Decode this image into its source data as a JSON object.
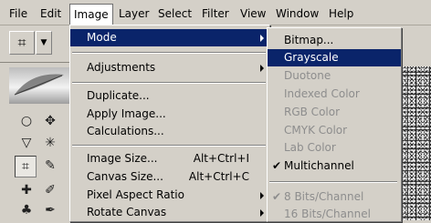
{
  "menubar": {
    "items": [
      "File",
      "Edit",
      "Image",
      "Layer",
      "Select",
      "Filter",
      "View",
      "Window",
      "Help"
    ],
    "active": "Image"
  },
  "image_menu": {
    "items": [
      {
        "label": "Mode",
        "has_submenu": true,
        "highlighted": true
      },
      {
        "label": "Adjustments",
        "has_submenu": true
      },
      {
        "label": "Duplicate..."
      },
      {
        "label": "Apply Image..."
      },
      {
        "label": "Calculations..."
      },
      {
        "label": "Image Size...",
        "shortcut": "Alt+Ctrl+I"
      },
      {
        "label": "Canvas Size...",
        "shortcut": "Alt+Ctrl+C"
      },
      {
        "label": "Pixel Aspect Ratio",
        "has_submenu": true
      },
      {
        "label": "Rotate Canvas",
        "has_submenu": true
      }
    ]
  },
  "mode_submenu": {
    "items": [
      {
        "label": "Bitmap..."
      },
      {
        "label": "Grayscale",
        "highlighted": true
      },
      {
        "label": "Duotone",
        "disabled": true
      },
      {
        "label": "Indexed Color",
        "disabled": true
      },
      {
        "label": "RGB Color",
        "disabled": true
      },
      {
        "label": "CMYK Color",
        "disabled": true
      },
      {
        "label": "Lab Color",
        "disabled": true
      },
      {
        "label": "Multichannel",
        "checked": true
      },
      {
        "label": "8 Bits/Channel",
        "checked": true,
        "disabled": true
      },
      {
        "label": "16 Bits/Channel",
        "disabled": true
      }
    ]
  },
  "colors": {
    "menu_bg": "#d4d0c8",
    "highlight": "#0a246a",
    "highlight_text": "#ffffff",
    "disabled_text": "#8d8d8d"
  },
  "icons": [
    "crop-icon",
    "lasso-icon",
    "magic-wand-icon",
    "slice-icon",
    "healing-brush-icon",
    "brush-icon",
    "stamp-icon",
    "feather-logo-icon"
  ]
}
